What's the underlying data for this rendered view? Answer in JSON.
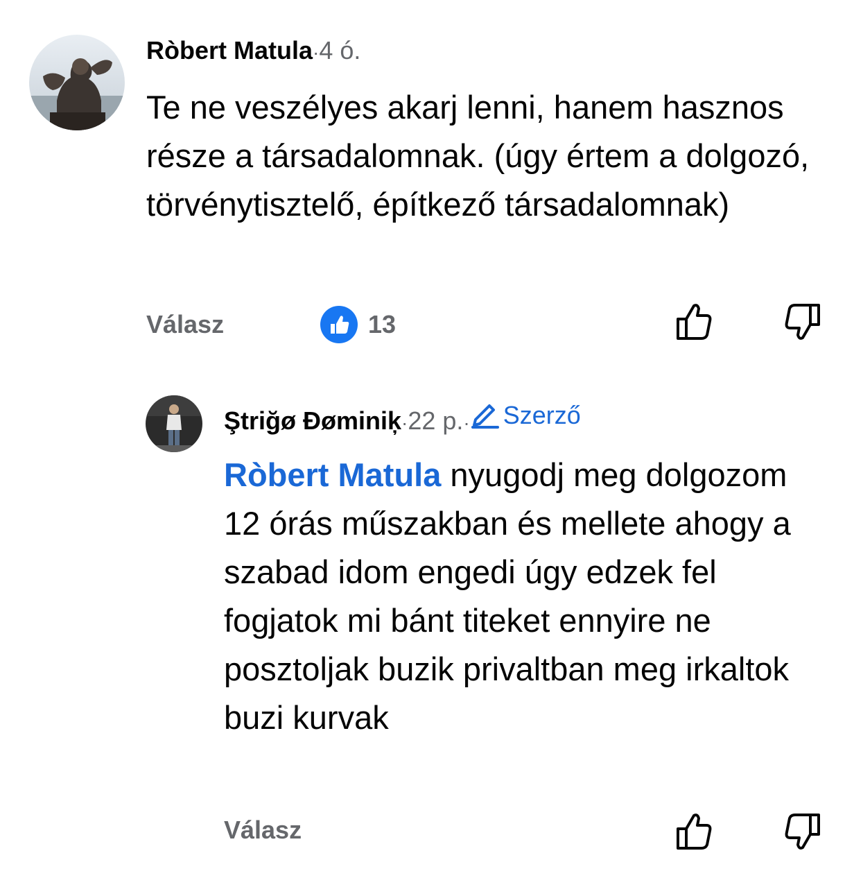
{
  "comments": [
    {
      "author": "Ròbert Matula",
      "separator": " · ",
      "time": "4 ó.",
      "text": "Te ne veszélyes akarj lenni, hanem hasznos része a társadalomnak. (úgy értem a dolgozó, törvénytisztelő, építkező társadalomnak)",
      "reply_label": "Válasz",
      "reaction_count": "13",
      "reaction_type": "like-icon"
    },
    {
      "author": "Ştriğø Đøminiķ",
      "separator": " · ",
      "time": "22 p.",
      "separator2": " · ",
      "badge": "Szerző",
      "mention": "Ròbert Matula",
      "text": " nyugodj meg dolgozom 12 órás műszakban és mellete ahogy a szabad idom engedi úgy edzek fel fogjatok mi bánt titeket ennyire ne posztoljak buzik privaltban meg irkaltok buzi kurvak",
      "reply_label": "Válasz"
    }
  ],
  "colors": {
    "accent": "#1a68d6",
    "like_badge": "#1877f2",
    "secondary_text": "#65676b"
  }
}
